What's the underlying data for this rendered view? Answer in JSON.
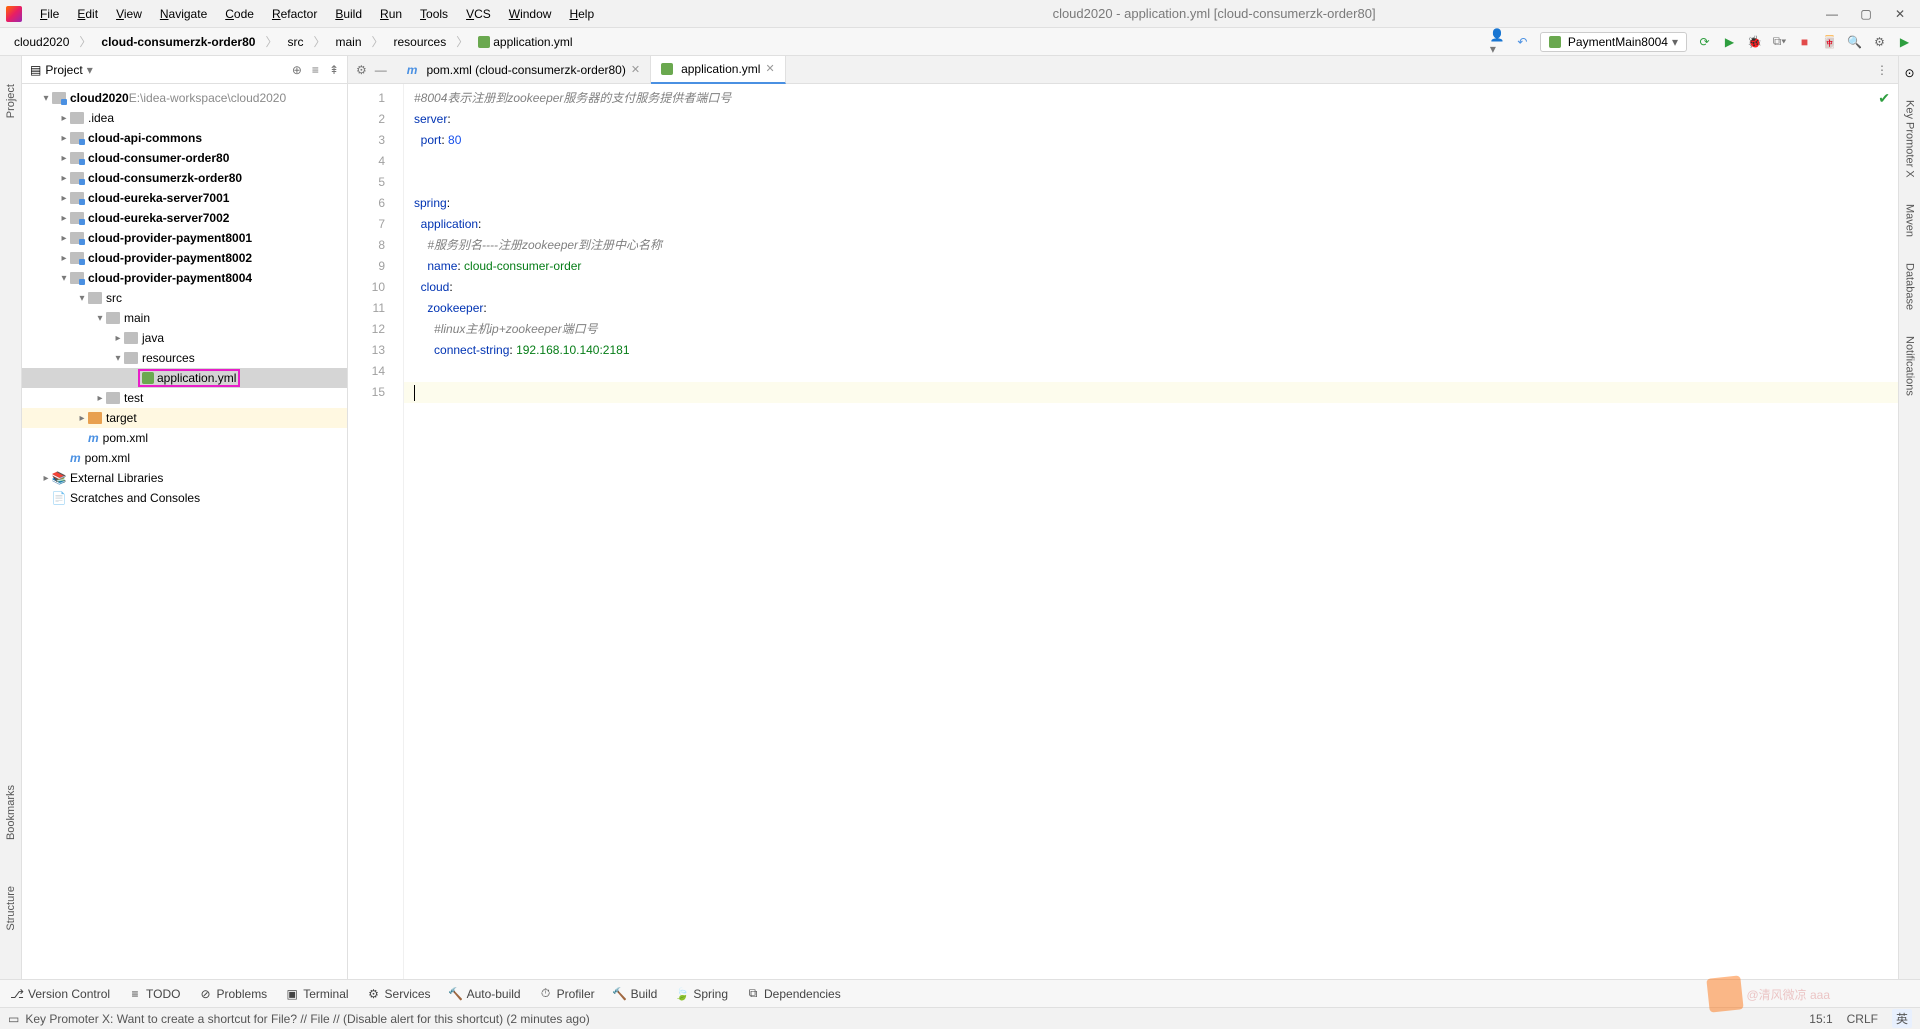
{
  "title": "cloud2020 - application.yml [cloud-consumerzk-order80]",
  "menu": [
    "File",
    "Edit",
    "View",
    "Navigate",
    "Code",
    "Refactor",
    "Build",
    "Run",
    "Tools",
    "VCS",
    "Window",
    "Help"
  ],
  "breadcrumb": [
    "cloud2020",
    "cloud-consumerzk-order80",
    "src",
    "main",
    "resources",
    "application.yml"
  ],
  "run_config": "PaymentMain8004",
  "left_tools": [
    "Project",
    "Bookmarks",
    "Structure"
  ],
  "right_tools": [
    "Key Promoter X",
    "Maven",
    "Database",
    "Notifications"
  ],
  "project": {
    "title": "Project",
    "root": {
      "name": "cloud2020",
      "path": "E:\\idea-workspace\\cloud2020"
    },
    "nodes": [
      {
        "name": ".idea",
        "t": "folder",
        "depth": 1,
        "arrow": "r"
      },
      {
        "name": "cloud-api-commons",
        "t": "mod",
        "depth": 1,
        "arrow": "r",
        "bold": true
      },
      {
        "name": "cloud-consumer-order80",
        "t": "mod",
        "depth": 1,
        "arrow": "r",
        "bold": true
      },
      {
        "name": "cloud-consumerzk-order80",
        "t": "mod",
        "depth": 1,
        "arrow": "r",
        "bold": true
      },
      {
        "name": "cloud-eureka-server7001",
        "t": "mod",
        "depth": 1,
        "arrow": "r",
        "bold": true
      },
      {
        "name": "cloud-eureka-server7002",
        "t": "mod",
        "depth": 1,
        "arrow": "r",
        "bold": true
      },
      {
        "name": "cloud-provider-payment8001",
        "t": "mod",
        "depth": 1,
        "arrow": "r",
        "bold": true
      },
      {
        "name": "cloud-provider-payment8002",
        "t": "mod",
        "depth": 1,
        "arrow": "r",
        "bold": true
      },
      {
        "name": "cloud-provider-payment8004",
        "t": "mod",
        "depth": 1,
        "arrow": "d",
        "bold": true
      },
      {
        "name": "src",
        "t": "folder",
        "depth": 2,
        "arrow": "d"
      },
      {
        "name": "main",
        "t": "folder",
        "depth": 3,
        "arrow": "d"
      },
      {
        "name": "java",
        "t": "folder",
        "depth": 4,
        "arrow": "r"
      },
      {
        "name": "resources",
        "t": "folder",
        "depth": 4,
        "arrow": "d"
      },
      {
        "name": "application.yml",
        "t": "yaml",
        "depth": 5,
        "selected": true,
        "hl": true
      },
      {
        "name": "test",
        "t": "folder",
        "depth": 3,
        "arrow": "r"
      },
      {
        "name": "target",
        "t": "folder-o",
        "depth": 2,
        "arrow": "r",
        "target": true
      },
      {
        "name": "pom.xml",
        "t": "pom",
        "depth": 2
      },
      {
        "name": "pom.xml",
        "t": "pom",
        "depth": 1
      },
      {
        "name": "External Libraries",
        "t": "lib",
        "depth": 0,
        "arrow": "r"
      },
      {
        "name": "Scratches and Consoles",
        "t": "scratch",
        "depth": 0
      }
    ]
  },
  "tabs": [
    {
      "label": "pom.xml (cloud-consumerzk-order80)",
      "type": "pom",
      "active": false
    },
    {
      "label": "application.yml",
      "type": "yaml",
      "active": true
    }
  ],
  "code_lines": [
    {
      "n": 1,
      "seg": [
        {
          "t": "#8004表示注册到zookeeper服务器的支付服务提供者端口号",
          "c": "c-comment"
        }
      ]
    },
    {
      "n": 2,
      "seg": [
        {
          "t": "server",
          "c": "c-key"
        },
        {
          "t": ":",
          "c": ""
        }
      ]
    },
    {
      "n": 3,
      "seg": [
        {
          "t": "  ",
          "c": ""
        },
        {
          "t": "port",
          "c": "c-key"
        },
        {
          "t": ": ",
          "c": ""
        },
        {
          "t": "80",
          "c": "c-num"
        }
      ]
    },
    {
      "n": 4,
      "seg": []
    },
    {
      "n": 5,
      "seg": []
    },
    {
      "n": 6,
      "seg": [
        {
          "t": "spring",
          "c": "c-key"
        },
        {
          "t": ":",
          "c": ""
        }
      ]
    },
    {
      "n": 7,
      "seg": [
        {
          "t": "  ",
          "c": ""
        },
        {
          "t": "application",
          "c": "c-key"
        },
        {
          "t": ":",
          "c": ""
        }
      ]
    },
    {
      "n": 8,
      "seg": [
        {
          "t": "    ",
          "c": ""
        },
        {
          "t": "#服务别名----注册zookeeper到注册中心名称",
          "c": "c-comment"
        }
      ]
    },
    {
      "n": 9,
      "seg": [
        {
          "t": "    ",
          "c": ""
        },
        {
          "t": "name",
          "c": "c-key"
        },
        {
          "t": ": ",
          "c": ""
        },
        {
          "t": "cloud-consumer-order",
          "c": "c-val"
        }
      ]
    },
    {
      "n": 10,
      "seg": [
        {
          "t": "  ",
          "c": ""
        },
        {
          "t": "cloud",
          "c": "c-key"
        },
        {
          "t": ":",
          "c": ""
        }
      ]
    },
    {
      "n": 11,
      "seg": [
        {
          "t": "    ",
          "c": ""
        },
        {
          "t": "zookeeper",
          "c": "c-key"
        },
        {
          "t": ":",
          "c": ""
        }
      ]
    },
    {
      "n": 12,
      "seg": [
        {
          "t": "      ",
          "c": ""
        },
        {
          "t": "#linux主机ip+zookeeper端口号",
          "c": "c-comment"
        }
      ]
    },
    {
      "n": 13,
      "seg": [
        {
          "t": "      ",
          "c": ""
        },
        {
          "t": "connect-string",
          "c": "c-key"
        },
        {
          "t": ": ",
          "c": ""
        },
        {
          "t": "192.168.10.140:2181",
          "c": "c-val"
        }
      ]
    },
    {
      "n": 14,
      "seg": []
    },
    {
      "n": 15,
      "seg": [],
      "cursor": true
    }
  ],
  "bottom_tools": [
    "Version Control",
    "TODO",
    "Problems",
    "Terminal",
    "Services",
    "Auto-build",
    "Profiler",
    "Build",
    "Spring",
    "Dependencies"
  ],
  "status": {
    "msg": "Key Promoter X: Want to create a shortcut for File? // File // (Disable alert for this shortcut) (2 minutes ago)",
    "pos": "15:1",
    "enc": "CRLF",
    "lang": "英"
  },
  "watermark": "@清风微凉 aaa"
}
